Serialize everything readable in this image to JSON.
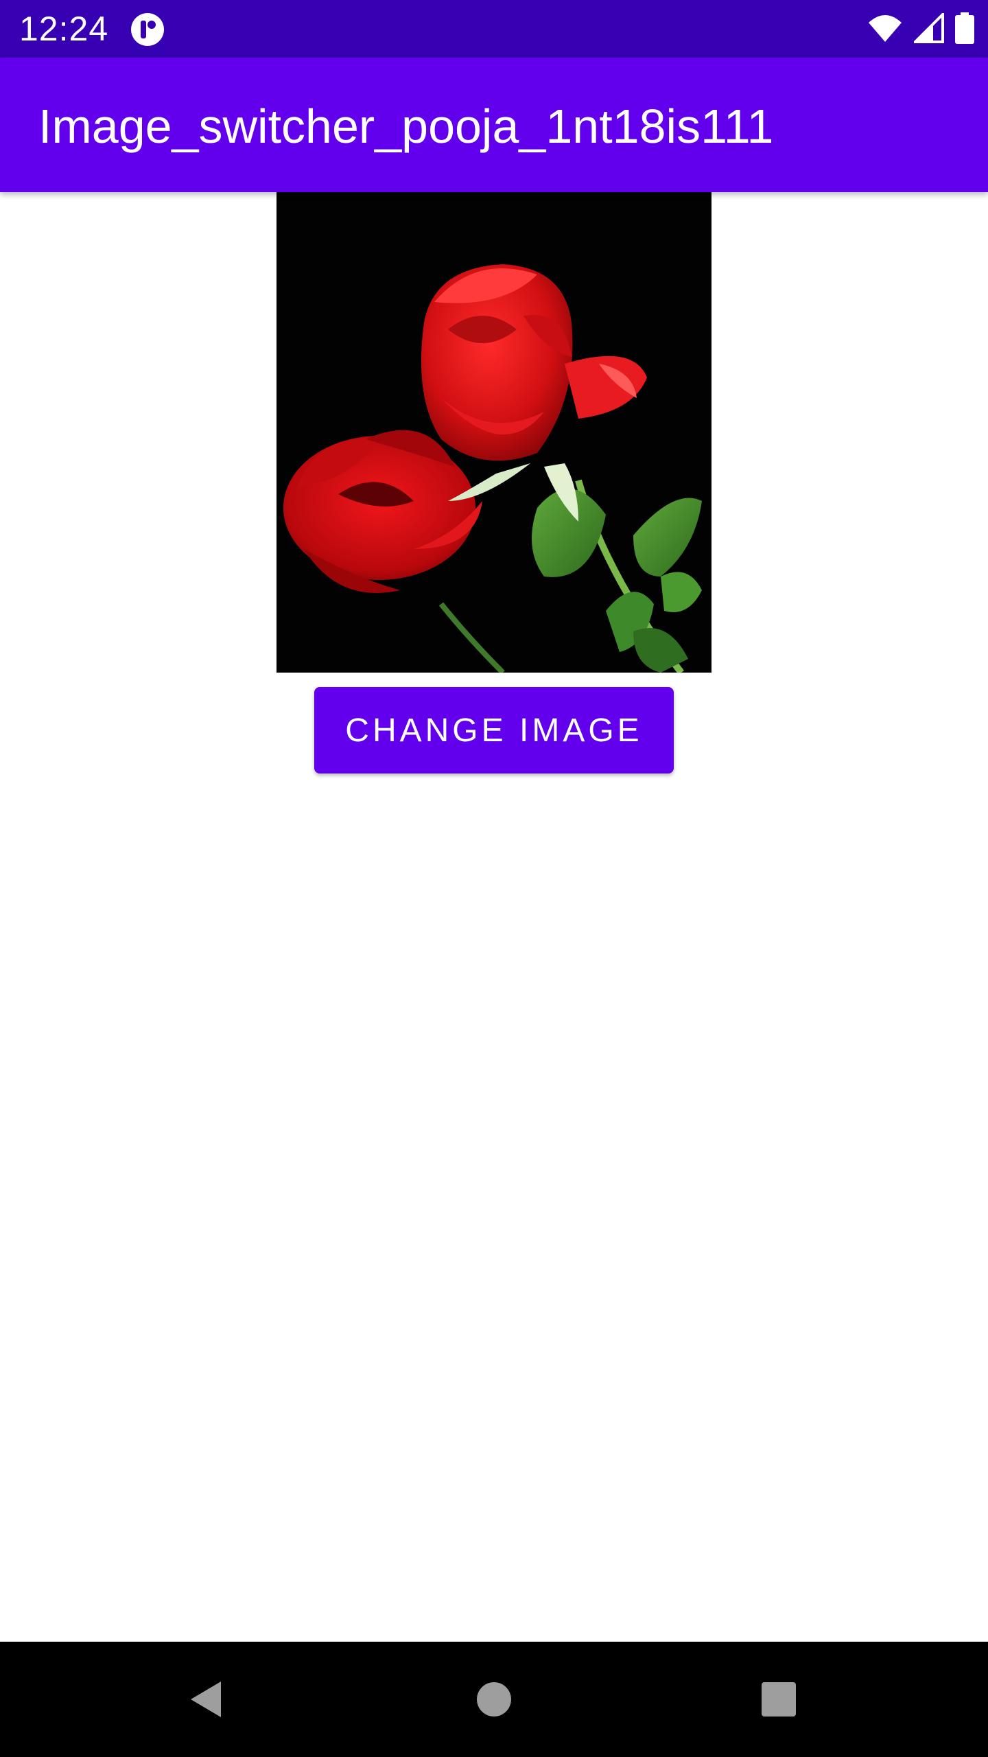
{
  "status_bar": {
    "time": "12:24",
    "bg_color": "#3700b3",
    "icons": [
      "app-notification-icon",
      "wifi-icon",
      "cell-signal-icon",
      "battery-icon"
    ]
  },
  "app_bar": {
    "title": "Image_switcher_pooja_1nt18is111",
    "bg_color": "#6200ee"
  },
  "main": {
    "image": {
      "subject": "red-roses-photo"
    },
    "change_button_label": "CHANGE IMAGE",
    "accent_color": "#6200ee"
  },
  "nav_bar": {
    "icons": [
      "back-icon",
      "home-icon",
      "recents-icon"
    ]
  }
}
